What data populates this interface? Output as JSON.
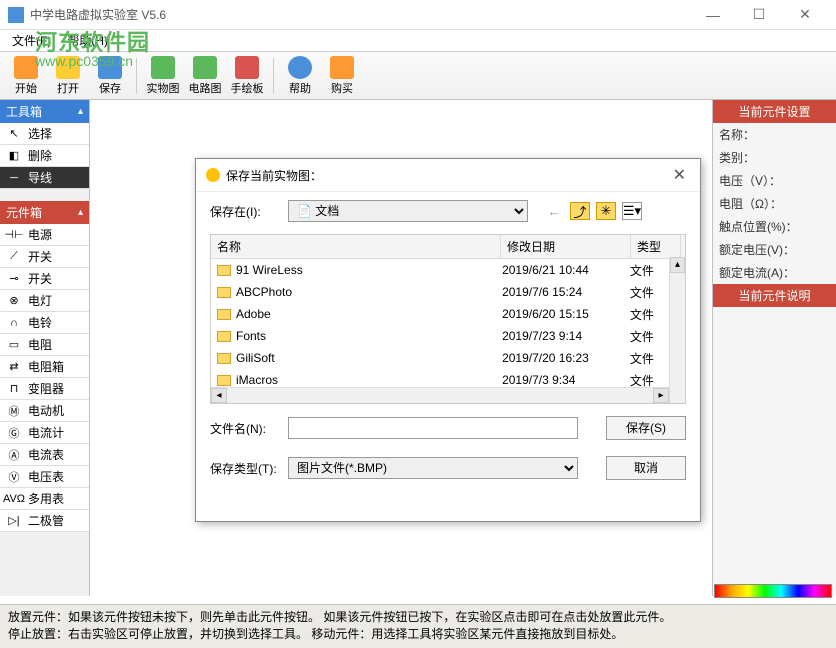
{
  "window": {
    "title": "中学电路虚拟实验室 V5.6"
  },
  "menubar": {
    "file": "文件(F)",
    "help": "帮助(H)"
  },
  "watermark": {
    "line1": "河东软件园",
    "line2": "www.pc0359.cn"
  },
  "toolbar": {
    "start": "开始",
    "open": "打开",
    "save": "保存",
    "realimg": "实物图",
    "circuit": "电路图",
    "sketch": "手绘板",
    "help": "帮助",
    "buy": "购买"
  },
  "toolbox": {
    "title": "工具箱",
    "select": "选择",
    "delete": "删除",
    "wire": "导线"
  },
  "components": {
    "title": "元件箱",
    "items": [
      {
        "sym": "⊣⊢",
        "label": "电源"
      },
      {
        "sym": "⟋",
        "label": "开关"
      },
      {
        "sym": "⊸",
        "label": "开关"
      },
      {
        "sym": "⊗",
        "label": "电灯"
      },
      {
        "sym": "∩",
        "label": "电铃"
      },
      {
        "sym": "▭",
        "label": "电阻"
      },
      {
        "sym": "⇄",
        "label": "电阻箱"
      },
      {
        "sym": "⊓",
        "label": "变阻器"
      },
      {
        "sym": "Ⓜ",
        "label": "电动机"
      },
      {
        "sym": "Ⓖ",
        "label": "电流计"
      },
      {
        "sym": "Ⓐ",
        "label": "电流表"
      },
      {
        "sym": "Ⓥ",
        "label": "电压表"
      },
      {
        "sym": "AVΩ",
        "label": "多用表"
      },
      {
        "sym": "▷|",
        "label": "二极管"
      }
    ]
  },
  "rightpanel": {
    "settings_hdr": "当前元件设置",
    "rows": [
      "名称：",
      "类别：",
      "电压（V）：",
      "电阻（Ω）：",
      "触点位置(%)：",
      "额定电压(V)：",
      "额定电流(A)："
    ],
    "desc_hdr": "当前元件说明"
  },
  "dialog": {
    "title": "保存当前实物图：",
    "savein_label": "保存在(I):",
    "location": "文档",
    "cols": {
      "name": "名称",
      "date": "修改日期",
      "type": "类型"
    },
    "files": [
      {
        "name": "91 WireLess",
        "date": "2019/6/21 10:44",
        "type": "文件"
      },
      {
        "name": "ABCPhoto",
        "date": "2019/7/6 15:24",
        "type": "文件"
      },
      {
        "name": "Adobe",
        "date": "2019/6/20 15:15",
        "type": "文件"
      },
      {
        "name": "Fonts",
        "date": "2019/7/23 9:14",
        "type": "文件"
      },
      {
        "name": "GiliSoft",
        "date": "2019/7/20 16:23",
        "type": "文件"
      },
      {
        "name": "iMacros",
        "date": "2019/7/3 9:34",
        "type": "文件"
      }
    ],
    "filename_label": "文件名(N):",
    "filename": "",
    "filetype_label": "保存类型(T):",
    "filetype": "图片文件(*.BMP)",
    "save_btn": "保存(S)",
    "cancel_btn": "取消"
  },
  "status": {
    "line1": "放置元件：如果该元件按钮未按下，则先单击此元件按钮。  如果该元件按钮已按下，在实验区点击即可在点击处放置此元件。",
    "line2": "停止放置：右击实验区可停止放置，并切换到选择工具。  移动元件：用选择工具将实验区某元件直接拖放到目标处。"
  }
}
